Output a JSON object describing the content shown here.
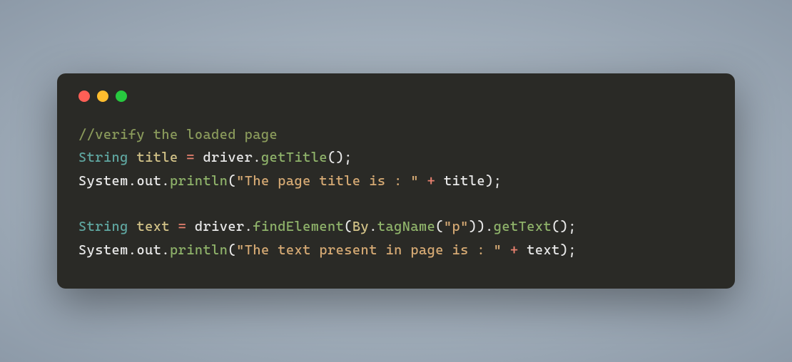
{
  "code": {
    "l1": {
      "comment": "//verify the loaded page"
    },
    "l2": {
      "type": "String",
      "var": "title",
      "op": " = ",
      "obj": "driver",
      "dot": ".",
      "method": "getTitle",
      "paren": "();"
    },
    "l3": {
      "obj1": "System",
      "d1": ".",
      "obj2": "out",
      "d2": ".",
      "method": "println",
      "po": "(",
      "str": "\"The page title is : \"",
      "plus": " + ",
      "var": "title",
      "pc": ");"
    },
    "l4": {
      "type": "String",
      "var": "text",
      "op": " = ",
      "obj": "driver",
      "d1": ".",
      "method1": "findElement",
      "po1": "(",
      "cls": "By",
      "d2": ".",
      "method2": "tagName",
      "po2": "(",
      "str": "\"p\"",
      "pc2": "))",
      "d3": ".",
      "method3": "getText",
      "pc3": "();"
    },
    "l5": {
      "obj1": "System",
      "d1": ".",
      "obj2": "out",
      "d2": ".",
      "method": "println",
      "po": "(",
      "str": "\"The text present in page is : \"",
      "plus": " + ",
      "var": "text",
      "pc": ");"
    }
  }
}
